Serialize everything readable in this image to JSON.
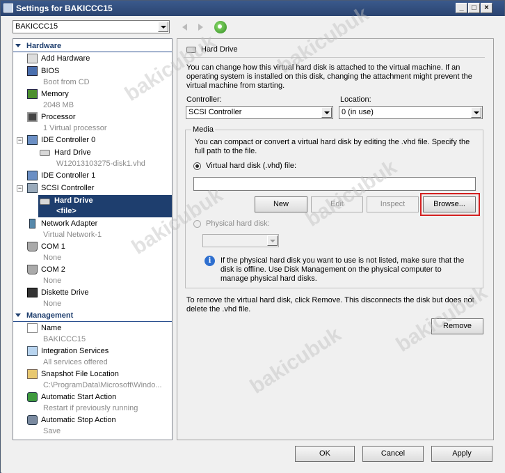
{
  "window": {
    "title": "Settings for BAKICCC15"
  },
  "vm_selector": {
    "value": "BAKICCC15"
  },
  "sidebar": {
    "hardware_header": "Hardware",
    "management_header": "Management",
    "hardware_items": [
      {
        "label": "Add Hardware",
        "sub": ""
      },
      {
        "label": "BIOS",
        "sub": "Boot from CD"
      },
      {
        "label": "Memory",
        "sub": "2048 MB"
      },
      {
        "label": "Processor",
        "sub": "1 Virtual processor"
      },
      {
        "label": "IDE Controller 0",
        "sub": ""
      },
      {
        "label": "Hard Drive",
        "sub": "W12013103275-disk1.vhd"
      },
      {
        "label": "IDE Controller 1",
        "sub": ""
      },
      {
        "label": "SCSI Controller",
        "sub": ""
      },
      {
        "label": "Hard Drive",
        "sub": "<file>"
      },
      {
        "label": "Network Adapter",
        "sub": "Virtual Network-1"
      },
      {
        "label": "COM 1",
        "sub": "None"
      },
      {
        "label": "COM 2",
        "sub": "None"
      },
      {
        "label": "Diskette Drive",
        "sub": "None"
      }
    ],
    "management_items": [
      {
        "label": "Name",
        "sub": "BAKICCC15"
      },
      {
        "label": "Integration Services",
        "sub": "All services offered"
      },
      {
        "label": "Snapshot File Location",
        "sub": "C:\\ProgramData\\Microsoft\\Windo..."
      },
      {
        "label": "Automatic Start Action",
        "sub": "Restart if previously running"
      },
      {
        "label": "Automatic Stop Action",
        "sub": "Save"
      }
    ]
  },
  "panel": {
    "title": "Hard Drive",
    "description": "You can change how this virtual hard disk is attached to the virtual machine. If an operating system is installed on this disk, changing the attachment might prevent the virtual machine from starting.",
    "controller_label": "Controller:",
    "controller_value": "SCSI Controller",
    "location_label": "Location:",
    "location_value": "0 (in use)",
    "media_label": "Media",
    "media_description": "You can compact or convert a virtual hard disk by editing the .vhd file. Specify the full path to the file.",
    "vhd_radio_label": "Virtual hard disk (.vhd) file:",
    "vhd_path_value": "",
    "new_label": "New",
    "edit_label": "Edit",
    "inspect_label": "Inspect",
    "browse_label": "Browse...",
    "physical_radio_label": "Physical hard disk:",
    "physical_info": "If the physical hard disk you want to use is not listed, make sure that the disk is offline. Use Disk Management on the physical computer to manage physical hard disks.",
    "remove_description": "To remove the virtual hard disk, click Remove. This disconnects the disk but does not delete the .vhd file.",
    "remove_label": "Remove"
  },
  "footer": {
    "ok_label": "OK",
    "cancel_label": "Cancel",
    "apply_label": "Apply"
  },
  "watermark": "bakicubuk",
  "colors": {
    "selection": "#1e3e6e",
    "highlight_box": "#d42020",
    "titlebar": "#2b4470"
  }
}
